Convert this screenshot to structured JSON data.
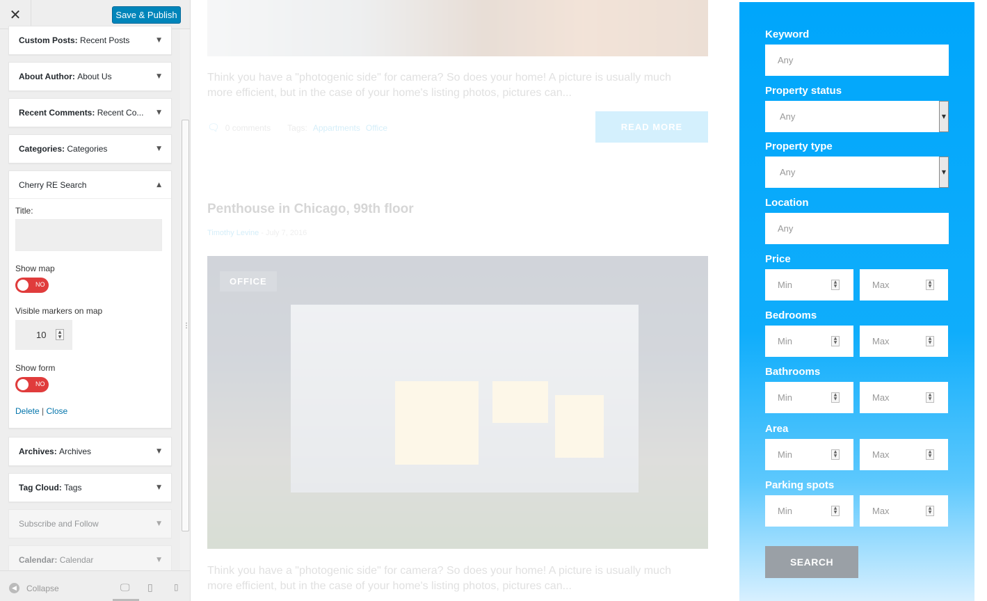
{
  "customizer": {
    "publish_label": "Save & Publish",
    "widgets_top": [
      {
        "type": "Custom Posts:",
        "name": "Recent Posts"
      },
      {
        "type": "About Author:",
        "name": "About Us"
      },
      {
        "type": "Recent Comments:",
        "name": "Recent Co..."
      },
      {
        "type": "Categories:",
        "name": "Categories"
      }
    ],
    "open_widget": {
      "title": "Cherry RE Search",
      "title_label": "Title:",
      "title_value": "",
      "show_map_label": "Show map",
      "show_map_toggle": "NO",
      "markers_label": "Visible markers on map",
      "markers_value": "10",
      "show_form_label": "Show form",
      "show_form_toggle": "NO",
      "delete_label": "Delete",
      "separator": "|",
      "close_label": "Close"
    },
    "widgets_bottom": [
      {
        "type": "Archives:",
        "name": "Archives"
      },
      {
        "type": "Tag Cloud:",
        "name": "Tags"
      },
      {
        "type": "",
        "name": "Subscribe and Follow"
      },
      {
        "type": "Calendar:",
        "name": "Calendar"
      }
    ],
    "collapse_label": "Collapse"
  },
  "preview": {
    "excerpt1": "Think you have a \"photogenic side\" for camera? So does your home! A picture is usually much more efficient, but in the case of your home's listing photos, pictures can...",
    "comments": "0 comments",
    "tags_label": "Tags:",
    "tag1": "Appartments",
    "tag2": "Office",
    "read_more": "READ MORE",
    "post_title": "Penthouse in Chicago, 99th floor",
    "author": "Timothy Levine",
    "meta_sep": "-",
    "date": "July 7, 2016",
    "category_tag": "OFFICE",
    "excerpt2": "Think you have a \"photogenic side\" for camera? So does your home! A picture is usually much more efficient, but in the case of your home's listing photos, pictures can..."
  },
  "search": {
    "keyword_label": "Keyword",
    "keyword_placeholder": "Any",
    "status_label": "Property status",
    "status_value": "Any",
    "type_label": "Property type",
    "type_value": "Any",
    "location_label": "Location",
    "location_placeholder": "Any",
    "price_label": "Price",
    "bedrooms_label": "Bedrooms",
    "bathrooms_label": "Bathrooms",
    "area_label": "Area",
    "parking_label": "Parking spots",
    "min_placeholder": "Min",
    "max_placeholder": "Max",
    "button_label": "SEARCH"
  }
}
